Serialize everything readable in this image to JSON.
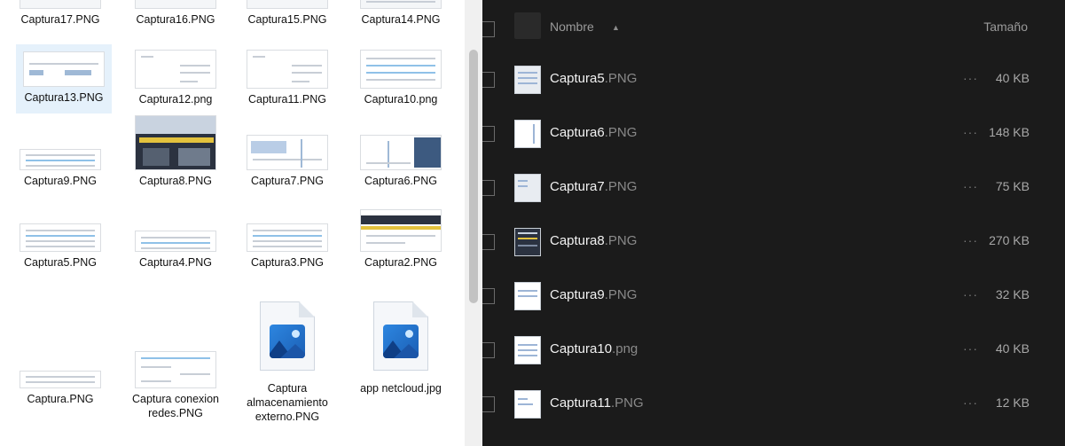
{
  "explorer": {
    "tiles": [
      {
        "label": "Captura17.PNG"
      },
      {
        "label": "Captura16.PNG"
      },
      {
        "label": "Captura15.PNG"
      },
      {
        "label": "Captura14.PNG"
      },
      {
        "label": "Captura13.PNG"
      },
      {
        "label": "Captura12.png"
      },
      {
        "label": "Captura11.PNG"
      },
      {
        "label": "Captura10.png"
      },
      {
        "label": "Captura9.PNG"
      },
      {
        "label": "Captura8.PNG"
      },
      {
        "label": "Captura7.PNG"
      },
      {
        "label": "Captura6.PNG"
      },
      {
        "label": "Captura5.PNG"
      },
      {
        "label": "Captura4.PNG"
      },
      {
        "label": "Captura3.PNG"
      },
      {
        "label": "Captura2.PNG"
      },
      {
        "label": "Captura.PNG"
      },
      {
        "label": "Captura conexion redes.PNG"
      },
      {
        "label": "Captura almacenamiento externo.PNG"
      },
      {
        "label": "app netcloud.jpg"
      }
    ],
    "selected": "Captura13.PNG",
    "file_type_icon": "image-file-icon"
  },
  "file_list": {
    "header": {
      "name_label": "Nombre",
      "sort_icon": "▲",
      "size_label": "Tamaño"
    },
    "rows": [
      {
        "base": "Captura5",
        "ext": ".PNG",
        "size": "40 KB",
        "menu": "···"
      },
      {
        "base": "Captura6",
        "ext": ".PNG",
        "size": "148 KB",
        "menu": "···"
      },
      {
        "base": "Captura7",
        "ext": ".PNG",
        "size": "75 KB",
        "menu": "···"
      },
      {
        "base": "Captura8",
        "ext": ".PNG",
        "size": "270 KB",
        "menu": "···"
      },
      {
        "base": "Captura9",
        "ext": ".PNG",
        "size": "32 KB",
        "menu": "···"
      },
      {
        "base": "Captura10",
        "ext": ".png",
        "size": "40 KB",
        "menu": "···"
      },
      {
        "base": "Captura11",
        "ext": ".PNG",
        "size": "12 KB",
        "menu": "···"
      }
    ]
  },
  "colors": {
    "explorer_bg": "#ffffff",
    "selection": "#e5f1fb",
    "dark_bg": "#1b1b1b"
  }
}
